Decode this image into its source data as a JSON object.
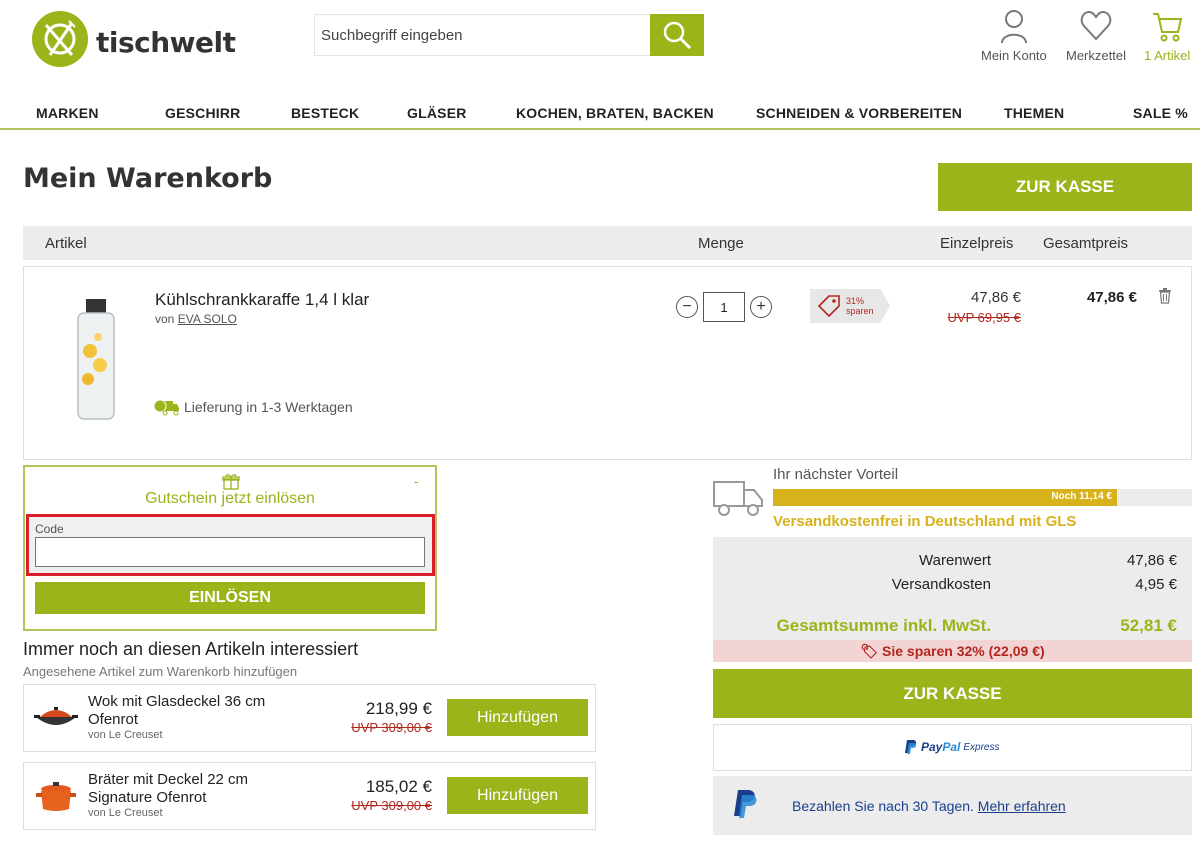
{
  "header": {
    "logo_text": "tischwelt",
    "search_placeholder": "Suchbegriff eingeben",
    "account_label": "Mein Konto",
    "wishlist_label": "Merkzettel",
    "cart_label": "1 Artikel"
  },
  "nav": [
    "MARKEN",
    "GESCHIRR",
    "BESTECK",
    "GLÄSER",
    "KOCHEN, BRATEN, BACKEN",
    "SCHNEIDEN & VORBEREITEN",
    "THEMEN",
    "SALE %"
  ],
  "page": {
    "title": "Mein Warenkorb",
    "checkout_label": "ZUR KASSE"
  },
  "table": {
    "col_article": "Artikel",
    "col_qty": "Menge",
    "col_unit": "Einzelpreis",
    "col_total": "Gesamtpreis"
  },
  "cart_item": {
    "name": "Kühlschrankkaraffe 1,4 l klar",
    "by_prefix": "von",
    "brand": "EVA SOLO",
    "delivery": "Lieferung in 1-3 Werktagen",
    "quantity": "1",
    "save_percent": "31%",
    "save_word": "sparen",
    "unit_price": "47,86 €",
    "uvp": "UVP 69,95 €",
    "total_price": "47,86 €"
  },
  "coupon": {
    "title": "Gutschein jetzt einlösen",
    "collapse": "-",
    "code_label": "Code",
    "code_value": "",
    "button": "EINLÖSEN"
  },
  "recommendations": {
    "title": "Immer noch an diesen Artikeln interessiert",
    "subtitle": "Angesehene Artikel zum Warenkorb hinzufügen",
    "items": [
      {
        "name_line1": "Wok mit Glasdeckel 36 cm",
        "name_line2": "Ofenrot",
        "brand": "von Le Creuset",
        "price": "218,99 €",
        "uvp": "UVP 309,00 €",
        "button": "Hinzufügen"
      },
      {
        "name_line1": "Bräter mit Deckel 22 cm",
        "name_line2": "Signature Ofenrot",
        "brand": "von Le Creuset",
        "price": "185,02 €",
        "uvp": "UVP 309,00 €",
        "button": "Hinzufügen"
      }
    ]
  },
  "benefit": {
    "label": "Ihr nächster Vorteil",
    "remaining": "Noch 11,14 €",
    "progress_fraction": 0.82,
    "text": "Versandkostenfrei in Deutschland mit GLS"
  },
  "summary": {
    "goods_label": "Warenwert",
    "goods_value": "47,86 €",
    "shipping_label": "Versandkosten",
    "shipping_value": "4,95 €",
    "total_label": "Gesamtsumme inkl. MwSt.",
    "total_value": "52,81 €",
    "savings": "Sie sparen 32% (22,09 €)",
    "checkout_label": "ZUR KASSE"
  },
  "payment": {
    "paypal_brand_1": "Pay",
    "paypal_brand_2": "Pal",
    "paypal_express": "Express",
    "paylater_text": "Bezahlen Sie nach 30 Tagen.",
    "paylater_link": "Mehr erfahren"
  },
  "colors": {
    "brand_green": "#9cb31a",
    "progress_gold": "#d8b21d",
    "strike_red": "#b3261e",
    "highlight_red": "#d9202a"
  }
}
